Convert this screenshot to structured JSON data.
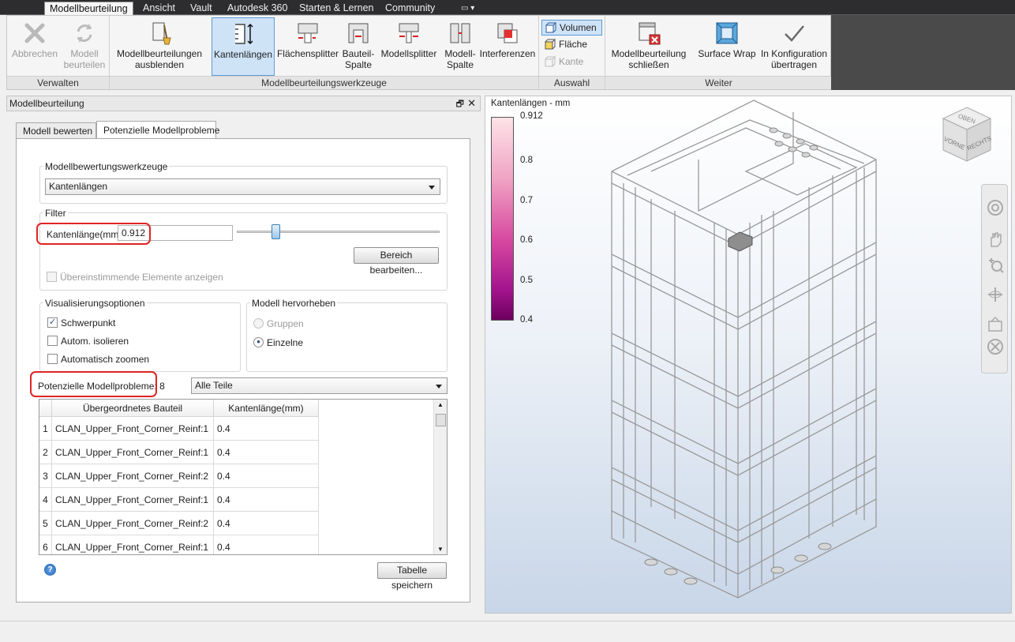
{
  "ribbon_tabs": [
    "Modellbeurteilung",
    "Ansicht",
    "Vault",
    "Autodesk 360",
    "Starten & Lernen",
    "Community"
  ],
  "ribbon": {
    "verwalten": {
      "title": "Verwalten",
      "abbrechen": "Abbrechen",
      "modell_beurteilen_1": "Modell",
      "modell_beurteilen_2": "beurteilen"
    },
    "werkzeuge": {
      "title": "Modellbeurteilungswerkzeuge",
      "ausblenden_1": "Modellbeurteilungen",
      "ausblenden_2": "ausblenden",
      "kantenlaengen": "Kantenlängen",
      "flaechensplitter": "Flächensplitter",
      "bauteil_1": "Bauteil-",
      "bauteil_2": "Spalte",
      "modellsplitter": "Modellsplitter",
      "modell_spalte_1": "Modell-",
      "modell_spalte_2": "Spalte",
      "interferenzen": "Interferenzen"
    },
    "auswahl": {
      "title": "Auswahl",
      "volumen": "Volumen",
      "flaeche": "Fläche",
      "kante": "Kante"
    },
    "weiter": {
      "title": "Weiter",
      "schliessen_1": "Modellbeurteilung",
      "schliessen_2": "schließen",
      "surface_wrap": "Surface Wrap",
      "konfig_1": "In Konfiguration",
      "konfig_2": "übertragen"
    }
  },
  "left_panel": {
    "title": "Modellbeurteilung",
    "tabs": [
      "Modell bewerten",
      "Potenzielle Modellprobleme"
    ],
    "tools_group": "Modellbewertungswerkzeuge",
    "tool_selected": "Kantenlängen",
    "filter_group": "Filter",
    "edge_label": "Kantenlänge(mm)",
    "edge_value": "0.912",
    "slider_fraction": 0.19,
    "range_button": "Bereich bearbeiten...",
    "matching_checkbox": "Übereinstimmende Elemente anzeigen",
    "vis_group": "Visualisierungsoptionen",
    "vis_options": {
      "schwerpunkt": "Schwerpunkt",
      "isolieren": "Autom. isolieren",
      "zoomen": "Automatisch zoomen"
    },
    "highlight_group": "Modell hervorheben",
    "highlight_options": {
      "gruppen": "Gruppen",
      "einzelne": "Einzelne"
    },
    "problems_label": "Potenzielle Modellprobleme: 8",
    "filter_combo": "Alle Teile",
    "table": {
      "headers": [
        "Übergeordnetes Bauteil",
        "Kantenlänge(mm)"
      ],
      "rows": [
        {
          "n": "1",
          "part": "CLAN_Upper_Front_Corner_Reinf:1",
          "len": "0.4"
        },
        {
          "n": "2",
          "part": "CLAN_Upper_Front_Corner_Reinf:1",
          "len": "0.4"
        },
        {
          "n": "3",
          "part": "CLAN_Upper_Front_Corner_Reinf:2",
          "len": "0.4"
        },
        {
          "n": "4",
          "part": "CLAN_Upper_Front_Corner_Reinf:1",
          "len": "0.4"
        },
        {
          "n": "5",
          "part": "CLAN_Upper_Front_Corner_Reinf:2",
          "len": "0.4"
        },
        {
          "n": "6",
          "part": "CLAN_Upper_Front_Corner_Reinf:1",
          "len": "0.4"
        }
      ]
    },
    "save_button": "Tabelle speichern"
  },
  "viewport": {
    "legend_title": "Kantenlängen - mm",
    "legend_ticks": [
      "0.912",
      "0.8",
      "0.7",
      "0.6",
      "0.5",
      "0.4"
    ],
    "viewcube": {
      "top": "OBEN",
      "front": "VORNE",
      "right": "RECHTS"
    }
  },
  "colors": {
    "accent": "#5b9bd5",
    "highlight_box": "#e02424",
    "tab_dark": "#2d2d30"
  }
}
